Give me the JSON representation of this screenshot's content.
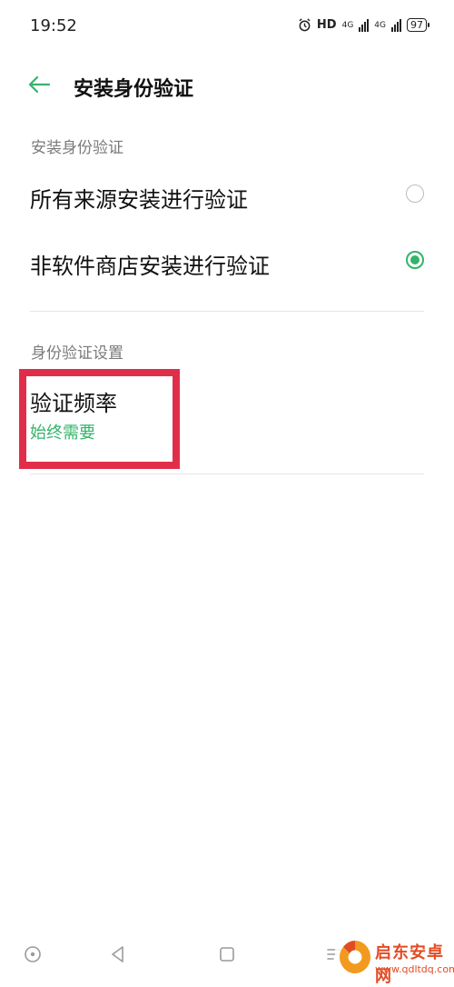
{
  "status_bar": {
    "time": "19:52",
    "hd": "HD",
    "network_1": "4G",
    "network_2": "4G",
    "battery": "97"
  },
  "header": {
    "title": "安装身份验证"
  },
  "sections": {
    "install": {
      "header": "安装身份验证",
      "options": [
        {
          "label": "所有来源安装进行验证",
          "checked": false
        },
        {
          "label": "非软件商店安装进行验证",
          "checked": true
        }
      ]
    },
    "settings": {
      "header": "身份验证设置",
      "frequency_title": "验证频率",
      "frequency_value": "始终需要"
    }
  },
  "watermark": {
    "name": "启东安卓网",
    "url": "www.qdltdq.com"
  },
  "colors": {
    "accent": "#34b36b",
    "highlight": "#e02e4a",
    "watermark": "#e24b24"
  }
}
